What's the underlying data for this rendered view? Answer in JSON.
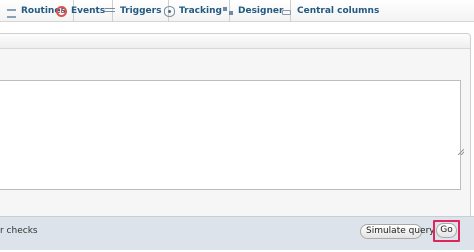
{
  "tabs": [
    {
      "id": "routines",
      "label": "Routines",
      "icon": "routines-icon"
    },
    {
      "id": "events",
      "label": "Events",
      "icon": "clock-icon"
    },
    {
      "id": "triggers",
      "label": "Triggers",
      "icon": "triggers-icon"
    },
    {
      "id": "tracking",
      "label": "Tracking",
      "icon": "eye-icon"
    },
    {
      "id": "designer",
      "label": "Designer",
      "icon": "designer-icon"
    },
    {
      "id": "central_columns",
      "label": "Central columns",
      "icon": "central-columns-icon"
    }
  ],
  "query": {
    "value": ""
  },
  "footer": {
    "checks_label": "r checks",
    "simulate_label": "Simulate query",
    "go_label": "Go"
  },
  "colors": {
    "tab_text": "#235a81",
    "footer_bg": "#dde3ea",
    "go_highlight": "#e0245e"
  }
}
